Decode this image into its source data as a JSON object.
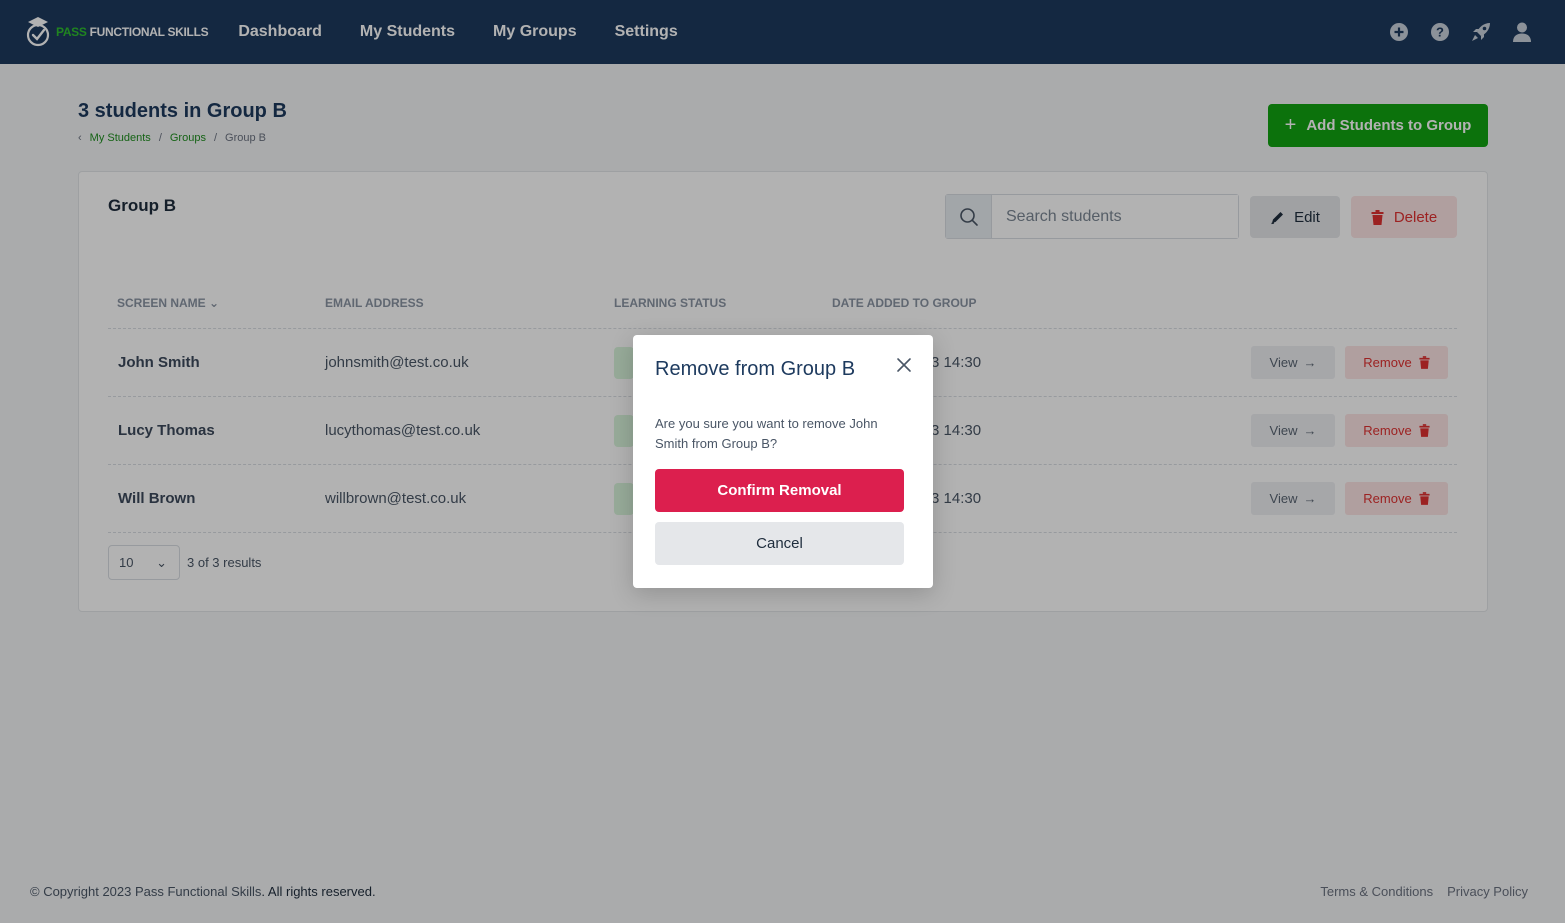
{
  "nav": {
    "logo_pass": "PASS",
    "logo_rest": "FUNCTIONAL SKILLS",
    "links": [
      "Dashboard",
      "My Students",
      "My Groups",
      "Settings"
    ],
    "icons": [
      "plus-circle-icon",
      "help-icon",
      "rocket-icon",
      "user-icon"
    ]
  },
  "header": {
    "title": "3 students in Group B",
    "breadcrumb": [
      "My Students",
      "Groups",
      "Group B"
    ],
    "add_button": "Add Students to Group"
  },
  "card": {
    "title": "Group B",
    "search_placeholder": "Search students",
    "edit_label": "Edit",
    "delete_label": "Delete",
    "columns": [
      "SCREEN NAME",
      "EMAIL ADDRESS",
      "LEARNING STATUS",
      "DATE ADDED TO GROUP"
    ],
    "rows": [
      {
        "name": "John Smith",
        "email": "johnsmith@test.co.uk",
        "date": "3 14:30",
        "view": "View",
        "remove": "Remove"
      },
      {
        "name": "Lucy Thomas",
        "email": "lucythomas@test.co.uk",
        "date": "3 14:30",
        "view": "View",
        "remove": "Remove"
      },
      {
        "name": "Will Brown",
        "email": "willbrown@test.co.uk",
        "date": "3 14:30",
        "view": "View",
        "remove": "Remove"
      }
    ],
    "page_size": "10",
    "results_text": "3 of 3 results"
  },
  "footer": {
    "copyright": "© Copyright 2023 Pass Functional Skills",
    "rights": ". All rights reserved.",
    "links": [
      "Terms & Conditions",
      "Privacy Policy"
    ]
  },
  "modal": {
    "title": "Remove from Group B",
    "body": "Are you sure you want to remove John Smith from Group B?",
    "confirm_label": "Confirm Removal",
    "cancel_label": "Cancel"
  },
  "colors": {
    "navbar": "#1d3a5e",
    "primary_green": "#12a412",
    "danger": "#dc1f4e"
  }
}
